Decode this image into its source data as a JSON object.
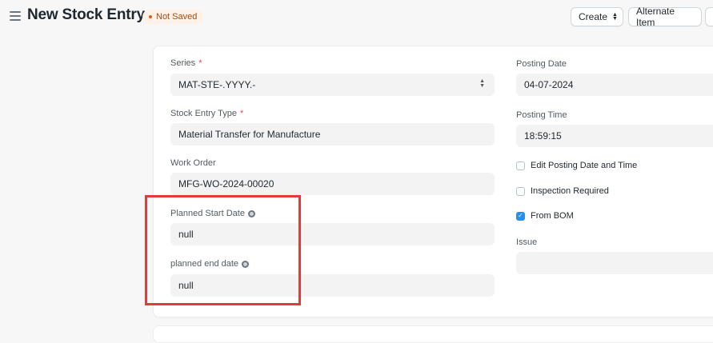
{
  "header": {
    "title": "New Stock Entry",
    "status": "Not Saved",
    "create_label": "Create",
    "alternate_item_label": "Alternate Item"
  },
  "form": {
    "series": {
      "label": "Series",
      "required_mark": "*",
      "value": "MAT-STE-.YYYY.-"
    },
    "stock_entry_type": {
      "label": "Stock Entry Type",
      "required_mark": "*",
      "value": "Material Transfer for Manufacture"
    },
    "work_order": {
      "label": "Work Order",
      "value": "MFG-WO-2024-00020"
    },
    "planned_start_date": {
      "label": "Planned Start Date",
      "value": "null"
    },
    "planned_end_date": {
      "label": "planned end date",
      "value": "null"
    },
    "posting_date": {
      "label": "Posting Date",
      "value": "04-07-2024"
    },
    "posting_time": {
      "label": "Posting Time",
      "value": "18:59:15"
    },
    "edit_posting": {
      "label": "Edit Posting Date and Time",
      "checked": false
    },
    "inspection_required": {
      "label": "Inspection Required",
      "checked": false
    },
    "from_bom": {
      "label": "From BOM",
      "checked": true
    },
    "issue": {
      "label": "Issue",
      "value": ""
    }
  },
  "colors": {
    "highlight": "#e23b3b",
    "accent": "#2490ef",
    "status_text": "#a64d0e",
    "status_bg": "#fff1e7"
  }
}
